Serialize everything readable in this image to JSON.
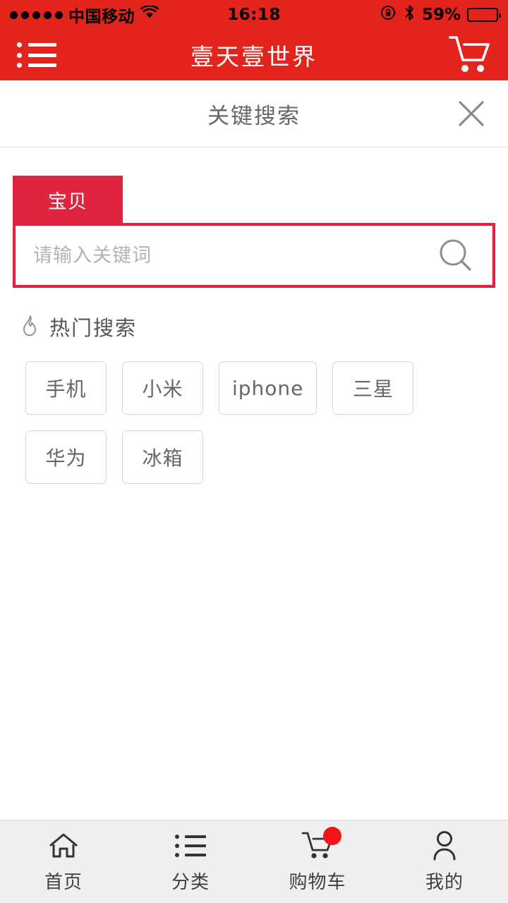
{
  "status_bar": {
    "signal_dots": 5,
    "carrier": "中国移动",
    "wifi_icon": "wifi-icon",
    "time": "16:18",
    "rotation_lock_icon": "rotation-lock-icon",
    "bluetooth_icon": "bluetooth-icon",
    "battery_percent": "59%",
    "battery_level": 59
  },
  "header": {
    "menu_icon": "list-menu-icon",
    "title": "壹天壹世界",
    "cart_icon": "shopping-cart-icon",
    "background_color": "#E3241C"
  },
  "sub_header": {
    "title": "关键搜索",
    "close_icon": "close-icon"
  },
  "search": {
    "tab_label": "宝贝",
    "tab_color": "#E0243F",
    "input_value": "",
    "placeholder": "请输入关键词",
    "search_icon": "search-icon"
  },
  "hot_search": {
    "flame_icon": "flame-icon",
    "title": "热门搜索",
    "tags": [
      {
        "label": "手机"
      },
      {
        "label": "小米"
      },
      {
        "label": "iphone"
      },
      {
        "label": "三星"
      },
      {
        "label": "华为"
      },
      {
        "label": "冰箱"
      }
    ]
  },
  "bottom_nav": {
    "badge_color": "#F5141A",
    "items": [
      {
        "label": "首页",
        "icon": "home-icon",
        "badge": false
      },
      {
        "label": "分类",
        "icon": "category-list-icon",
        "badge": false
      },
      {
        "label": "购物车",
        "icon": "shopping-cart-icon",
        "badge": true
      },
      {
        "label": "我的",
        "icon": "user-profile-icon",
        "badge": false
      }
    ]
  }
}
